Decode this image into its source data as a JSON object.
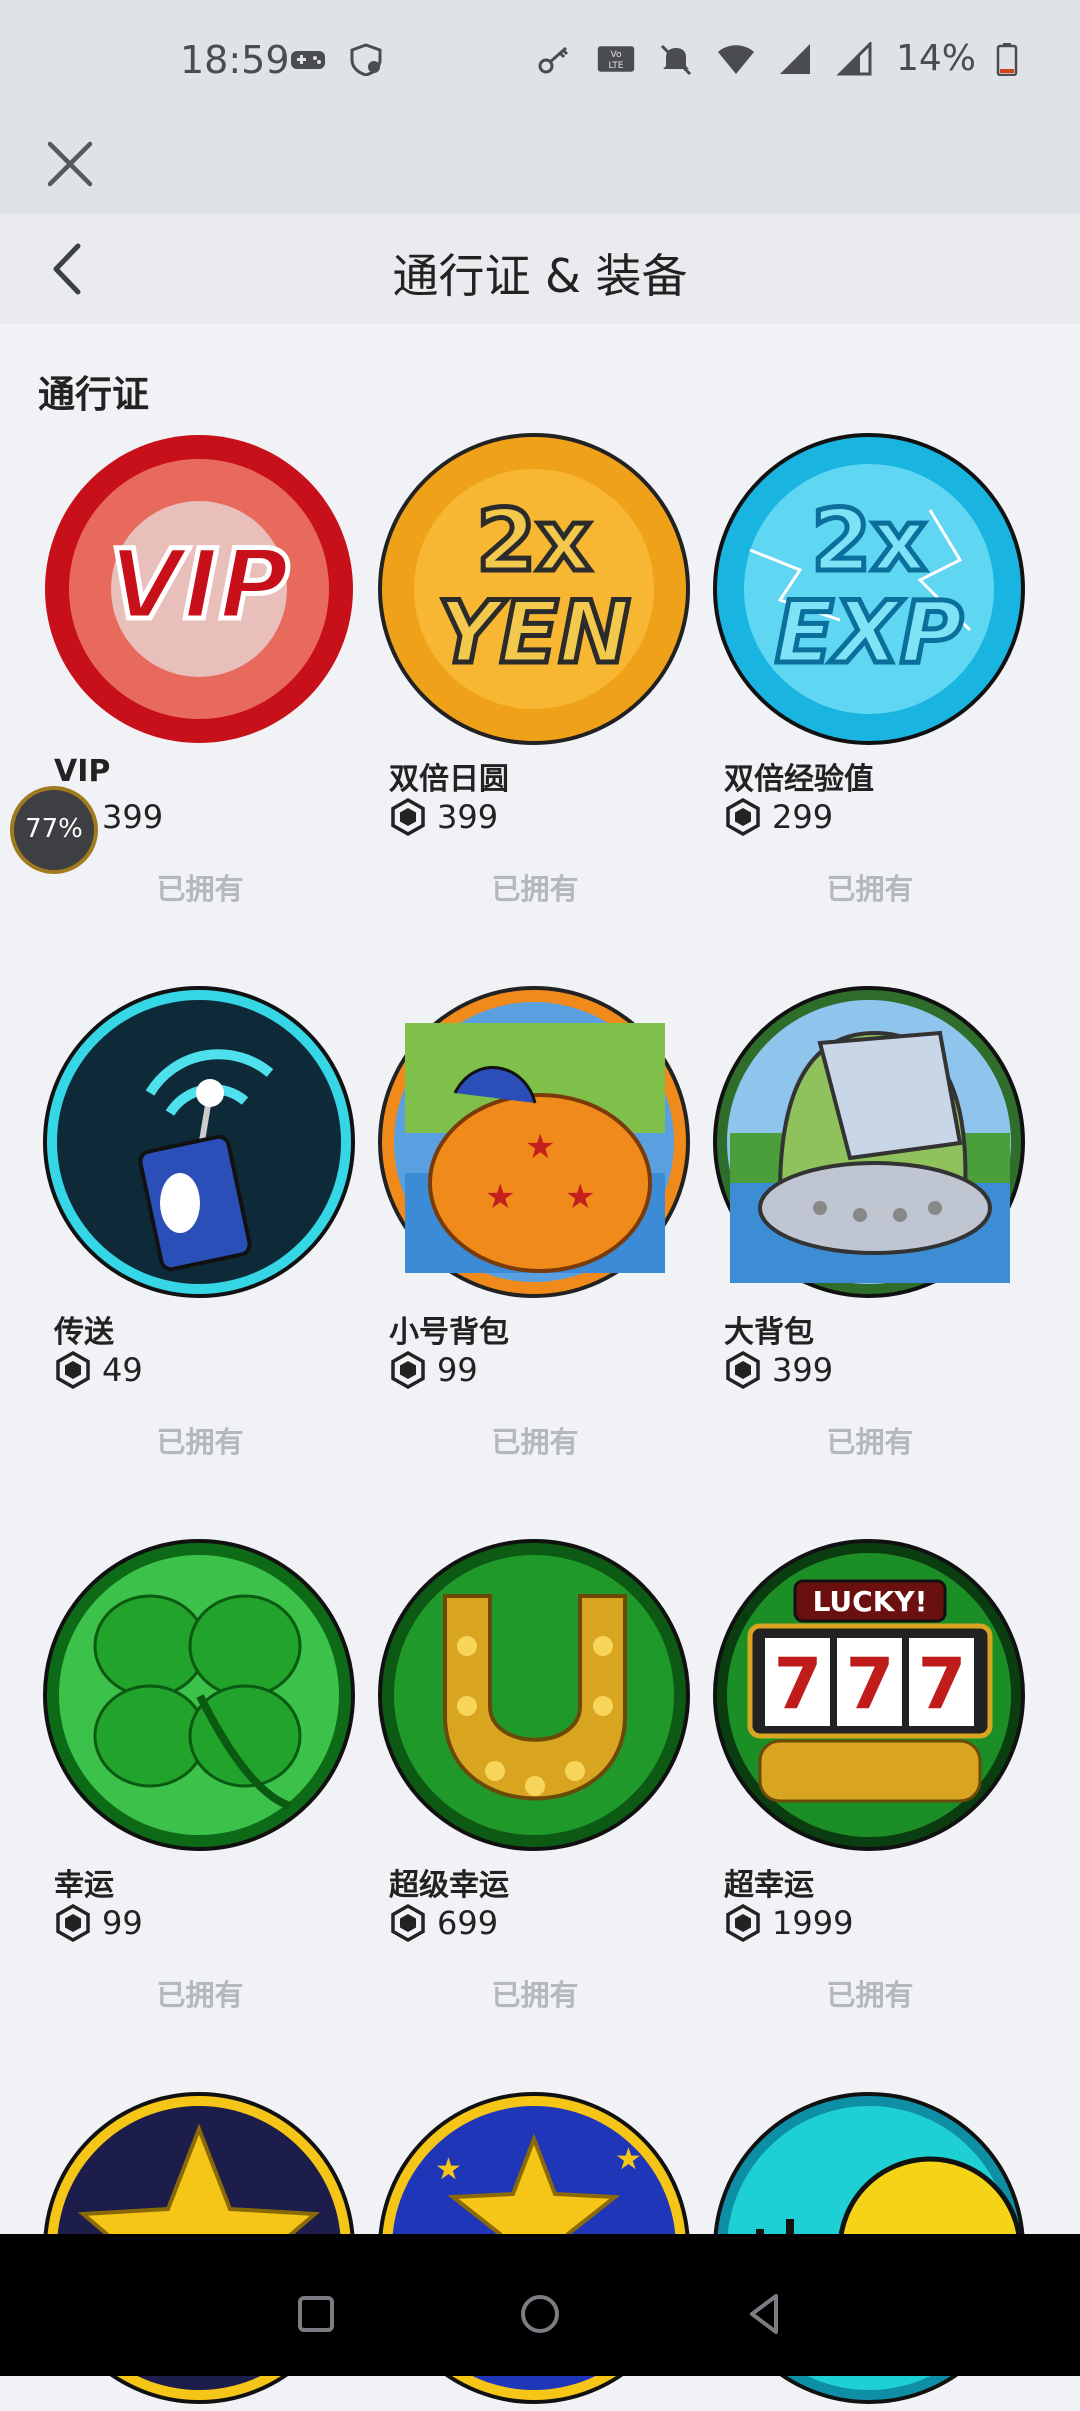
{
  "status_bar": {
    "time": "18:59",
    "battery": "14%",
    "left_icons": [
      "gamepad-icon",
      "shield-icon"
    ],
    "right_icons": [
      "key-icon",
      "volte-icon",
      "mute-icon",
      "wifi-icon",
      "signal-icon",
      "signal2-icon",
      "battery-icon"
    ]
  },
  "header": {
    "title": "通行证 & 装备"
  },
  "section": {
    "title": "通行证"
  },
  "perf_badge": "77%",
  "items": [
    {
      "name": "VIP",
      "price": "399",
      "status": "已拥有",
      "theme": "vip",
      "colors": [
        "#c8101a",
        "#e9e4e4"
      ]
    },
    {
      "name": "双倍日圆",
      "price": "399",
      "status": "已拥有",
      "theme": "yen",
      "colors": [
        "#f0a11a",
        "#2b2b2b"
      ]
    },
    {
      "name": "双倍经验值",
      "price": "299",
      "status": "已拥有",
      "theme": "exp",
      "colors": [
        "#19b4e0",
        "#ffffff"
      ]
    },
    {
      "name": "传送",
      "price": "49",
      "status": "已拥有",
      "theme": "teleport",
      "colors": [
        "#0e2a38",
        "#2b4fb8"
      ]
    },
    {
      "name": "小号背包",
      "price": "99",
      "status": "已拥有",
      "theme": "smallbag",
      "colors": [
        "#3b8bd6",
        "#f08a1a"
      ]
    },
    {
      "name": "大背包",
      "price": "399",
      "status": "已拥有",
      "theme": "bigbag",
      "colors": [
        "#4a9e3c",
        "#c9d6e8"
      ]
    },
    {
      "name": "幸运",
      "price": "99",
      "status": "已拥有",
      "theme": "clover",
      "colors": [
        "#22a32c",
        "#3cc24a"
      ]
    },
    {
      "name": "超级幸运",
      "price": "699",
      "status": "已拥有",
      "theme": "horseshoe",
      "colors": [
        "#1f9a2a",
        "#d9a521"
      ]
    },
    {
      "name": "超幸运",
      "price": "1999",
      "status": "已拥有",
      "theme": "slots",
      "colors": [
        "#1b8f26",
        "#c01c1c"
      ]
    },
    {
      "theme": "star",
      "colors": [
        "#1c1d4a",
        "#f5c518"
      ]
    },
    {
      "theme": "stars",
      "colors": [
        "#2036b8",
        "#f5c518"
      ]
    },
    {
      "theme": "cyan",
      "colors": [
        "#1ecfd4",
        "#f5d418"
      ]
    }
  ],
  "lucky_text": "LUCKY!",
  "slot_digits": [
    "7",
    "7",
    "7"
  ],
  "icon_text": {
    "vip": "VIP",
    "yen_top": "2x",
    "yen_bottom": "YEN",
    "exp_top": "2x",
    "exp_bottom": "EXP"
  }
}
